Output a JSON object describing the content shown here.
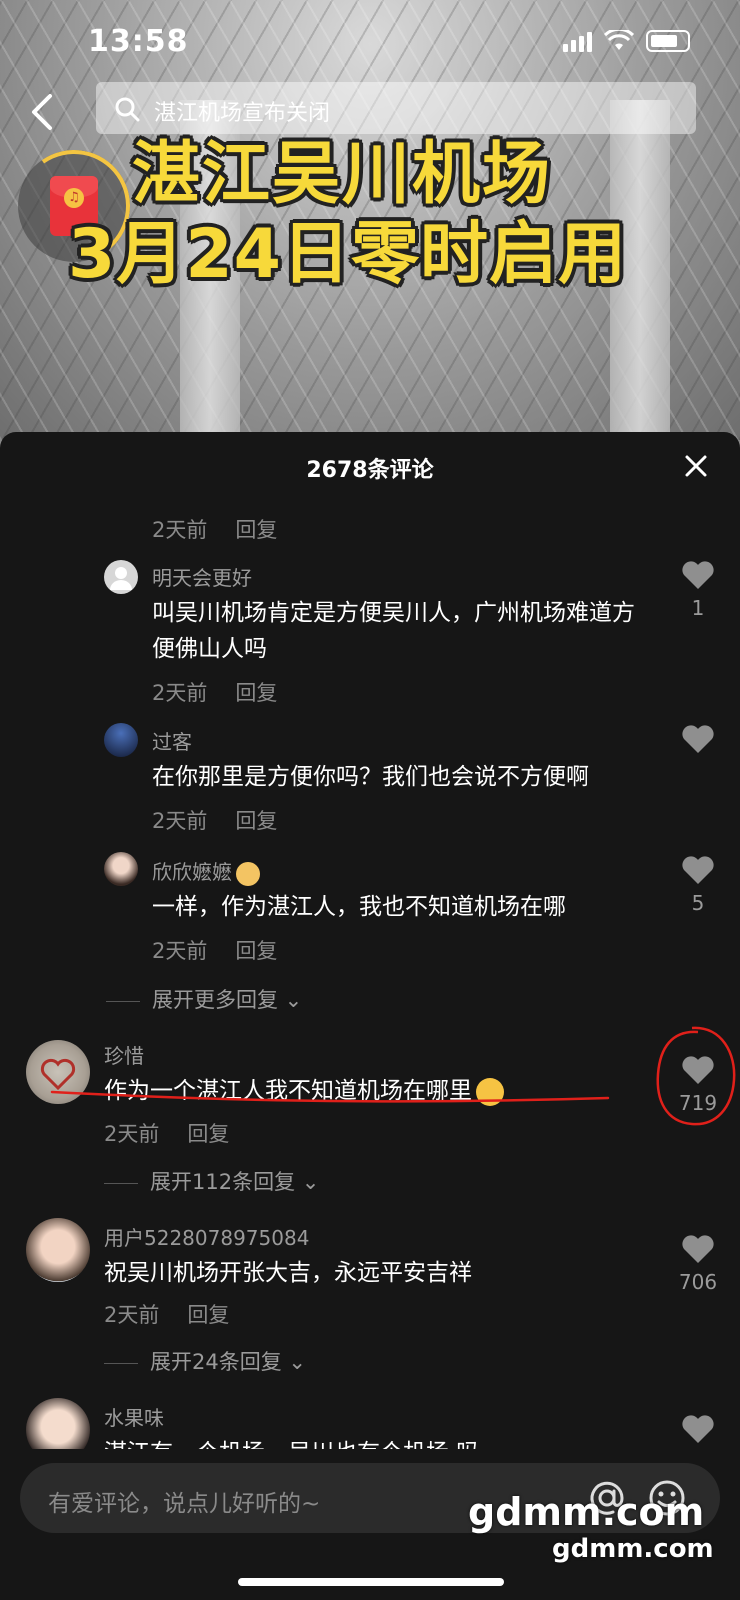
{
  "status_bar": {
    "time": "13:58"
  },
  "video": {
    "search_text": "湛江机场宣布关闭",
    "title_line1": "湛江吴川机场",
    "title_line2": "3月24日零时启用"
  },
  "panel": {
    "comment_count": "2678条评论"
  },
  "comments": [
    {
      "time": "2天前",
      "reply": "回复"
    },
    {
      "user": "明天会更好",
      "text": "叫吴川机场肯定是方便吴川人，广州机场难道方便佛山人吗",
      "time": "2天前",
      "reply": "回复",
      "likes": "1"
    },
    {
      "user": "过客",
      "text": "在你那里是方便你吗？我们也会说不方便啊",
      "time": "2天前",
      "reply": "回复",
      "likes": ""
    },
    {
      "user": "欣欣嬷嬷",
      "text": "一样，作为湛江人，我也不知道机场在哪",
      "time": "2天前",
      "reply": "回复",
      "likes": "5"
    },
    {
      "expand": "展开更多回复"
    },
    {
      "user": "珍惜",
      "text": "作为一个湛江人我不知道机场在哪里",
      "time": "2天前",
      "reply": "回复",
      "likes": "719"
    },
    {
      "expand": "展开112条回复"
    },
    {
      "user": "用户5228078975084",
      "text": "祝吴川机场开张大吉，永远平安吉祥",
      "time": "2天前",
      "reply": "回复",
      "likes": "706"
    },
    {
      "expand": "展开24条回复"
    },
    {
      "user": "水果味",
      "text": "湛江有一个机场，吴川也有个机场 吗",
      "likes": ""
    }
  ],
  "input": {
    "placeholder": "有爱评论，说点儿好听的~"
  },
  "watermark": {
    "main": "gdmm.com",
    "sub": "gdmm.com"
  },
  "colors": {
    "title_yellow": "#f7d93a",
    "annotation_red": "#e0201a",
    "panel_bg": "#161616"
  }
}
